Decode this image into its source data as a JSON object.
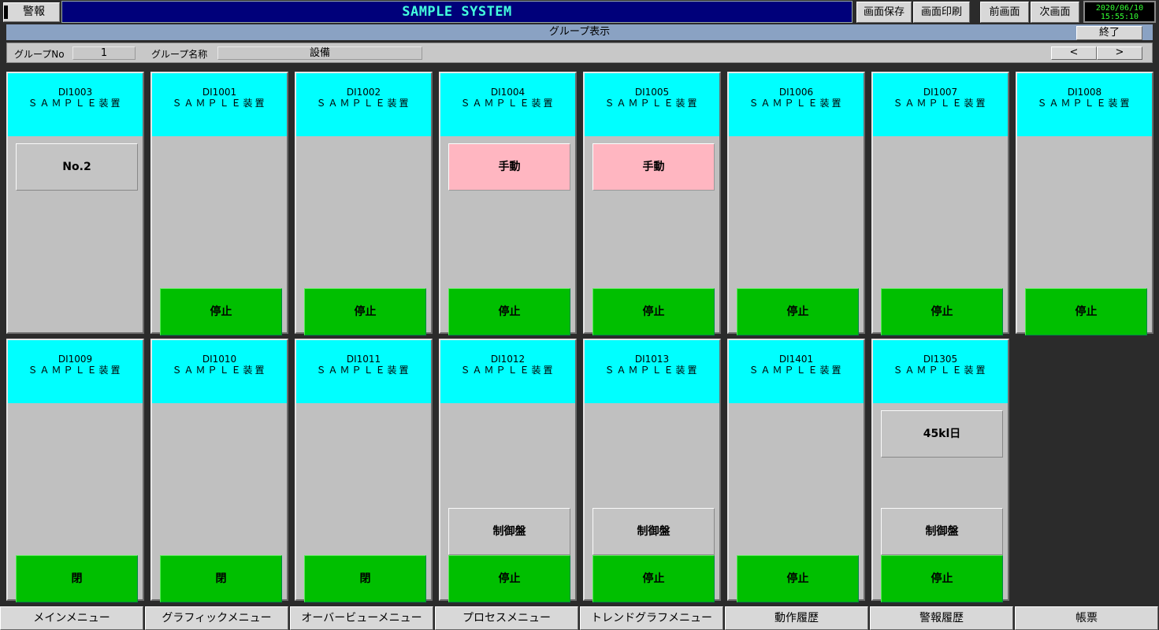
{
  "header": {
    "alarm_label": "警報",
    "title": "SAMPLE SYSTEM",
    "buttons": {
      "save_screen": "画面保存",
      "print_screen": "画面印刷",
      "prev_screen": "前画面",
      "next_screen": "次画面"
    },
    "clock": {
      "date": "2020/06/10",
      "time": "15:55:10"
    }
  },
  "group_band": {
    "title": "グループ表示",
    "end_label": "終了"
  },
  "info": {
    "group_no_label": "グループNo",
    "group_no_value": "1",
    "group_name_label": "グループ名称",
    "group_name_value": "設備",
    "prev": "<",
    "next": ">"
  },
  "cards": [
    {
      "id": "DI1003",
      "name": "ＳＡＭＰＬＥ装置",
      "cells": [
        "No.2",
        "",
        ""
      ]
    },
    {
      "id": "DI1001",
      "name": "ＳＡＭＰＬＥ装置",
      "cells": [
        "",
        "",
        "停止"
      ]
    },
    {
      "id": "DI1002",
      "name": "ＳＡＭＰＬＥ装置",
      "cells": [
        "",
        "",
        "停止"
      ]
    },
    {
      "id": "DI1004",
      "name": "ＳＡＭＰＬＥ装置",
      "cells": [
        "手動",
        "",
        "停止"
      ]
    },
    {
      "id": "DI1005",
      "name": "ＳＡＭＰＬＥ装置",
      "cells": [
        "手動",
        "",
        "停止"
      ]
    },
    {
      "id": "DI1006",
      "name": "ＳＡＭＰＬＥ装置",
      "cells": [
        "",
        "",
        "停止"
      ]
    },
    {
      "id": "DI1007",
      "name": "ＳＡＭＰＬＥ装置",
      "cells": [
        "",
        "",
        "停止"
      ]
    },
    {
      "id": "DI1008",
      "name": "ＳＡＭＰＬＥ装置",
      "cells": [
        "",
        "",
        "停止"
      ]
    },
    {
      "id": "DI1009",
      "name": "ＳＡＭＰＬＥ装置",
      "cells": [
        "",
        "",
        "閉"
      ]
    },
    {
      "id": "DI1010",
      "name": "ＳＡＭＰＬＥ装置",
      "cells": [
        "",
        "",
        "閉"
      ]
    },
    {
      "id": "DI1011",
      "name": "ＳＡＭＰＬＥ装置",
      "cells": [
        "",
        "",
        "閉"
      ]
    },
    {
      "id": "DI1012",
      "name": "ＳＡＭＰＬＥ装置",
      "cells": [
        "",
        "制御盤",
        "停止"
      ]
    },
    {
      "id": "DI1013",
      "name": "ＳＡＭＰＬＥ装置",
      "cells": [
        "",
        "制御盤",
        "停止"
      ]
    },
    {
      "id": "DI1401",
      "name": "ＳＡＭＰＬＥ装置",
      "cells": [
        "",
        "",
        "停止"
      ]
    },
    {
      "id": "DI1305",
      "name": "ＳＡＭＰＬＥ装置",
      "cells": [
        "45kl日",
        "制御盤",
        "停止"
      ]
    }
  ],
  "bottom_menu": [
    "メインメニュー",
    "グラフィックメニュー",
    "オーバービューメニュー",
    "プロセスメニュー",
    "トレンドグラフメニュー",
    "動作履歴",
    "警報履歴",
    "帳票"
  ],
  "colors": {
    "card_header": "#00ffff",
    "status_green": "#00bf00",
    "manual_pink": "#ffb6c1",
    "title_bg": "#00007a",
    "title_text": "#44ffdd"
  }
}
